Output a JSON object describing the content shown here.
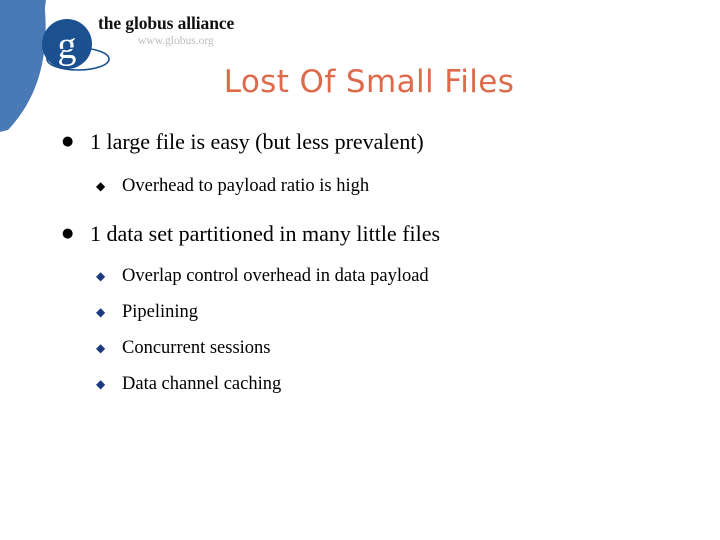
{
  "slide": {
    "title": "Lost Of Small Files",
    "title_color": "#dd6a4b",
    "background_color": "#ffffff"
  },
  "header": {
    "banner_color": "#4a7ab5",
    "swoosh_color": "#ffffff",
    "logo": {
      "mark_icon": "globus-g-logo-icon",
      "mark_circle_color": "#1b5091",
      "mark_letter": "g",
      "brand_name": "the globus alliance",
      "brand_url": "www.globus.org",
      "brand_url_color": "#b9bcc2"
    }
  },
  "content": {
    "bullet_marker_level1": "●",
    "bullet_marker_level2": "◆",
    "groups": [
      {
        "text": "1 large file is easy (but less prevalent)",
        "marker_color": "#000000",
        "sub_marker_color": "#000000",
        "sub_items": [
          {
            "text": "Overhead to payload ratio is high"
          }
        ]
      },
      {
        "text": "1 data set partitioned in many little files",
        "marker_color": "#000000",
        "sub_marker_color": "#1b3a80",
        "sub_items": [
          {
            "text": "Overlap control overhead in data payload"
          },
          {
            "text": "Pipelining"
          },
          {
            "text": "Concurrent sessions"
          },
          {
            "text": "Data channel caching"
          }
        ]
      }
    ]
  }
}
